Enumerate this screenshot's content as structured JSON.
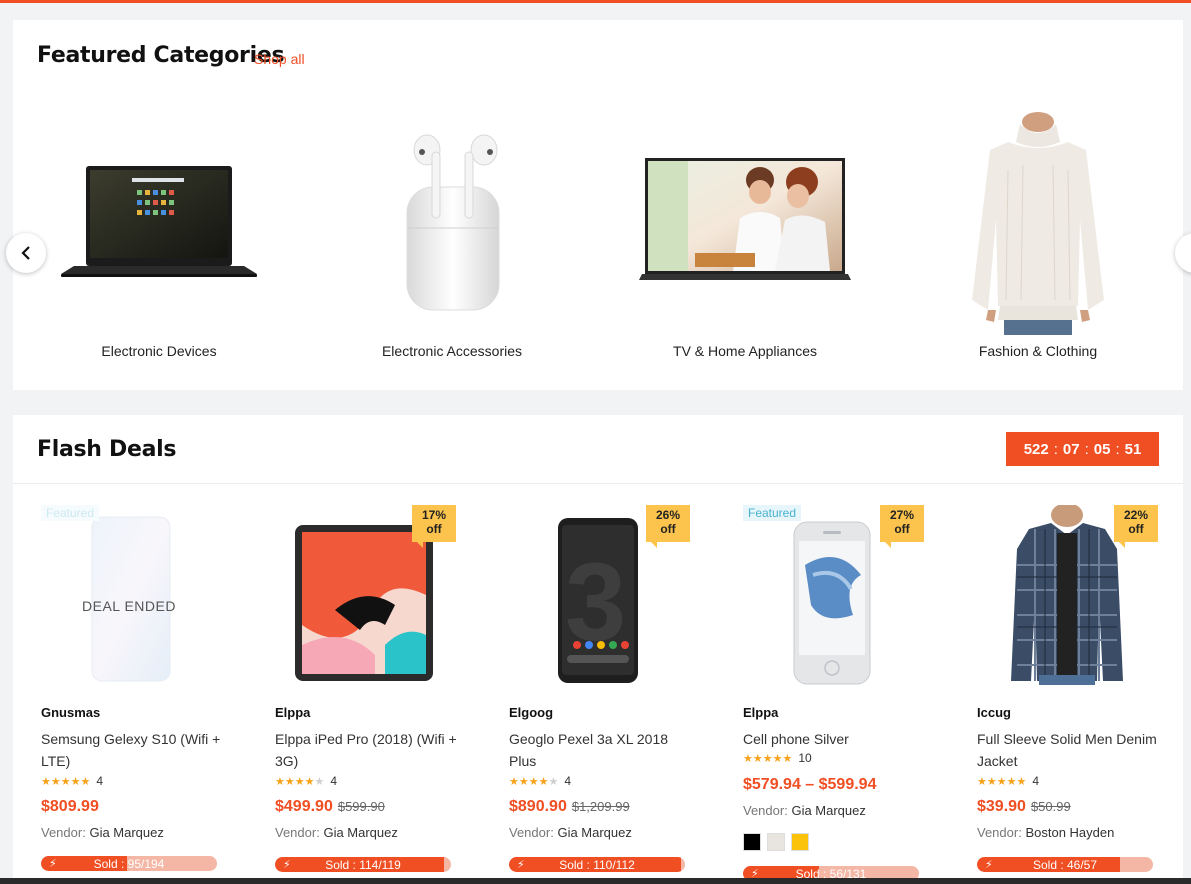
{
  "featured": {
    "title": "Featured Categories",
    "shop_all": "Shop all",
    "categories": [
      {
        "label": "Electronic Devices",
        "icon": "laptop-image"
      },
      {
        "label": "Electronic Accessories",
        "icon": "airpods-image"
      },
      {
        "label": "TV & Home Appliances",
        "icon": "tv-image"
      },
      {
        "label": "Fashion & Clothing",
        "icon": "sweater-image"
      }
    ]
  },
  "flash": {
    "title": "Flash Deals",
    "countdown": {
      "days": "522",
      "hours": "07",
      "minutes": "05",
      "seconds": "51"
    },
    "products": [
      {
        "badge": "Featured",
        "status": "DEAL ENDED",
        "vendor": "Gnusmas",
        "name": "Semsung Gelexy S10 (Wifi + LTE)",
        "rating": 5,
        "reviews": "4",
        "price": "$809.99",
        "old_price": "",
        "vendor_label": "Vendor:",
        "vendor_name": "Gia Marquez",
        "sold": "Sold : 95/194",
        "sold_fraction": 0.49
      },
      {
        "discount": "17%",
        "discount_off": "off",
        "vendor": "Elppa",
        "name": "Elppa iPed Pro (2018) (Wifi + 3G)",
        "rating": 4,
        "reviews": "4",
        "price": "$499.90",
        "old_price": "$599.90",
        "vendor_label": "Vendor:",
        "vendor_name": "Gia Marquez",
        "sold": "Sold : 114/119",
        "sold_fraction": 0.96
      },
      {
        "discount": "26%",
        "discount_off": "off",
        "vendor": "Elgoog",
        "name": "Geoglo Pexel 3a XL 2018 Plus",
        "rating": 4.5,
        "reviews": "4",
        "price": "$890.90",
        "old_price": "$1,209.99",
        "vendor_label": "Vendor:",
        "vendor_name": "Gia Marquez",
        "sold": "Sold : 110/112",
        "sold_fraction": 0.98
      },
      {
        "badge": "Featured",
        "discount": "27%",
        "discount_off": "off",
        "vendor": "Elppa",
        "name": "Cell phone Silver",
        "rating": 5,
        "reviews": "10",
        "price": "$579.94 – $599.94",
        "old_price": "",
        "vendor_label": "Vendor:",
        "vendor_name": "Gia Marquez",
        "colors": [
          "#000000",
          "#e8e5e0",
          "#fcc30d"
        ],
        "sold": "Sold : 56/131",
        "sold_fraction": 0.43
      },
      {
        "discount": "22%",
        "discount_off": "off",
        "vendor": "Iccug",
        "name": "Full Sleeve Solid Men Denim Jacket",
        "rating": 4.5,
        "reviews": "4",
        "price": "$39.90",
        "old_price": "$50.99",
        "vendor_label": "Vendor:",
        "vendor_name": "Boston Hayden",
        "sold": "Sold : 46/57",
        "sold_fraction": 0.81
      }
    ]
  },
  "colors": {
    "accent": "#f04e23",
    "discount": "#fcc44c",
    "star": "#f7a21b"
  }
}
